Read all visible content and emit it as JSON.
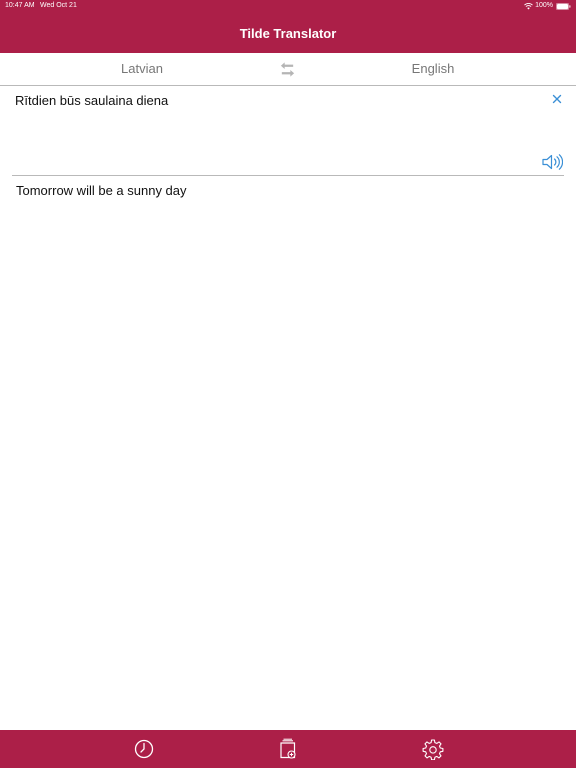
{
  "status_bar": {
    "time": "10:47 AM",
    "date": "Wed Oct 21",
    "battery": "100%"
  },
  "nav": {
    "title": "Tilde Translator"
  },
  "languages": {
    "source": "Latvian",
    "target": "English"
  },
  "translation": {
    "source_text": "Rītdien būs saulaina diena",
    "target_text": "Tomorrow will be a sunny day"
  },
  "icons": {
    "swap": "swap-arrows-icon",
    "clear": "close-icon",
    "speak": "speaker-icon",
    "history": "clock-icon",
    "documents": "document-add-icon",
    "settings": "gear-icon"
  },
  "colors": {
    "brand": "#ac1f48",
    "accent": "#3a8fd6",
    "muted": "#9a9a9a"
  }
}
